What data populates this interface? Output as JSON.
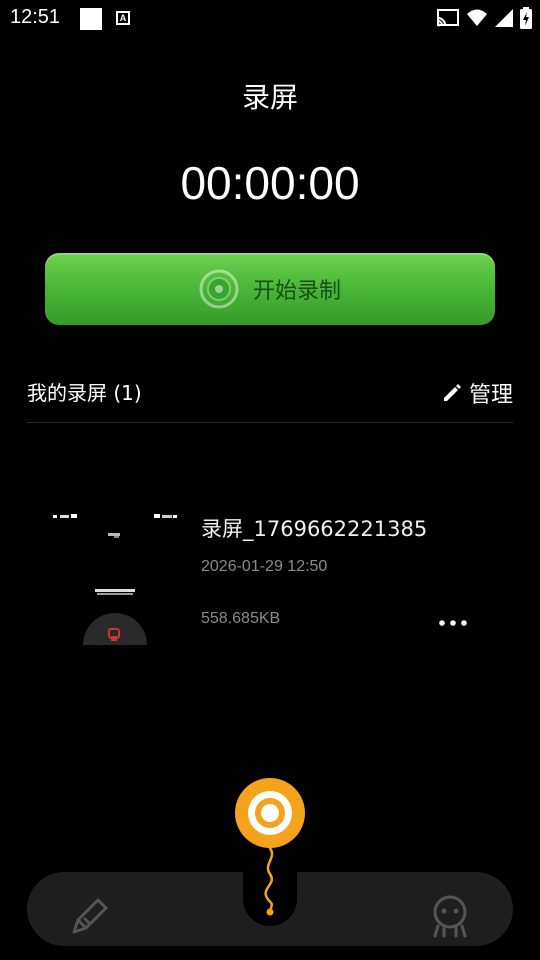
{
  "status_bar": {
    "time": "12:51",
    "icon_a": "A"
  },
  "screen": {
    "title": "录屏",
    "timer": "00:00:00"
  },
  "record_button": {
    "label": "开始录制"
  },
  "recordings": {
    "header": "我的录屏 (1)",
    "manage_label": "管理",
    "items": [
      {
        "name": "录屏_1769662221385",
        "date": "2026-01-29 12:50",
        "size": "558.685KB"
      }
    ]
  },
  "colors": {
    "accent_green": "#4cb83a",
    "fab_orange": "#f5a21c"
  }
}
